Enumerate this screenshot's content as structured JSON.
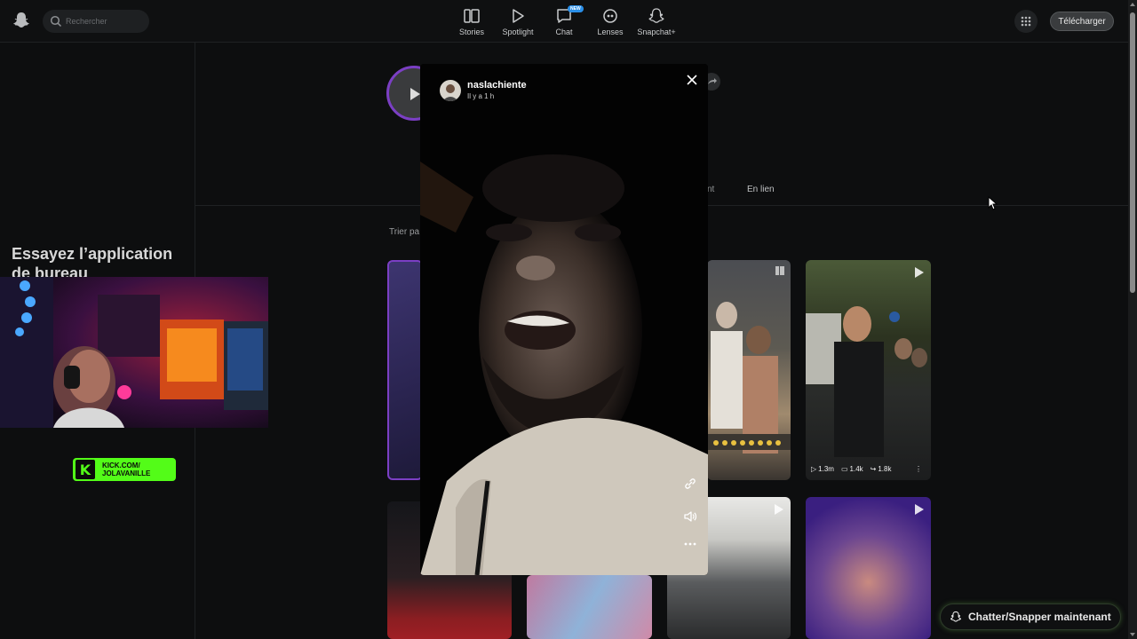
{
  "topbar": {
    "search_placeholder": "Rechercher",
    "nav": [
      {
        "label": "Stories",
        "icon": "stories-icon"
      },
      {
        "label": "Spotlight",
        "icon": "play-icon"
      },
      {
        "label": "Chat",
        "icon": "chat-icon",
        "badge": "NEW"
      },
      {
        "label": "Lenses",
        "icon": "lens-icon"
      },
      {
        "label": "Snapchat+",
        "icon": "ghost-plus-icon"
      }
    ],
    "download_label": "Télécharger"
  },
  "left_panel": {
    "promo_title": "Essayez l’application de bureau",
    "kick_line1": "KICK.COM/",
    "kick_line2": "JOLAVANILLE"
  },
  "profile": {
    "tab_fragment": "nt",
    "tab_enlien": "En lien",
    "sort_fragment": "Trier pa"
  },
  "tiles": {
    "stats": {
      "views": "1.3m",
      "comments": "1.4k",
      "shares": "1.8k"
    },
    "more": "⋮"
  },
  "modal": {
    "username": "naslachiente",
    "time": "Il y a 1 h"
  },
  "chat_now": {
    "label": "Chatter/Snapper maintenant"
  },
  "colors": {
    "accent": "#7b3fc4",
    "kick_green": "#53fc18",
    "badge_blue": "#2a8fe8"
  }
}
